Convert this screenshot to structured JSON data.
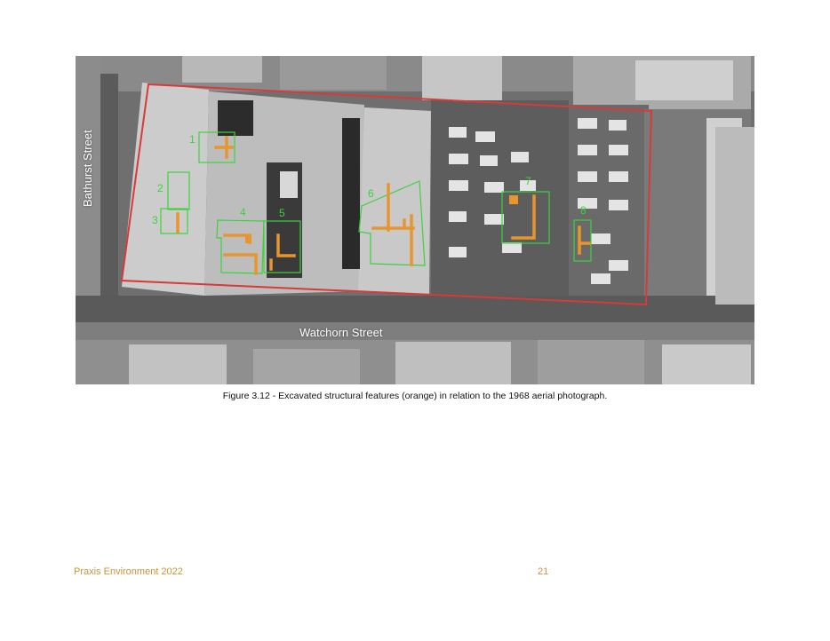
{
  "map": {
    "streets": {
      "bathurst": "Bathurst Street",
      "watchorn": "Watchorn Street"
    },
    "features": [
      {
        "id": "1"
      },
      {
        "id": "2"
      },
      {
        "id": "3"
      },
      {
        "id": "4"
      },
      {
        "id": "5"
      },
      {
        "id": "6"
      },
      {
        "id": "7"
      },
      {
        "id": "8"
      }
    ],
    "colors": {
      "site_boundary": "#d63a3a",
      "feature_outline": "#3cd23c",
      "structural_features": "#e8952e"
    }
  },
  "caption": "Figure 3.12 - Excavated structural features (orange) in relation to the 1968 aerial photograph.",
  "footer": {
    "left": "Praxis Environment 2022",
    "page_number": "21"
  }
}
